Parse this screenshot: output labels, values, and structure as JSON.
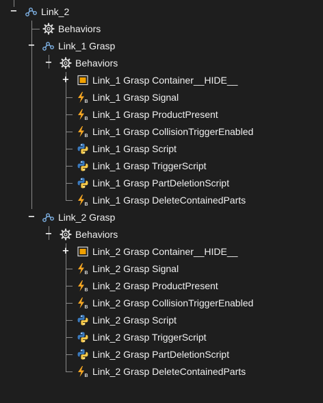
{
  "tree": {
    "root": {
      "label": "Link_2",
      "toggle": "−",
      "icon": "link-joint-icon"
    },
    "behaviors_root": {
      "label": "Behaviors",
      "icon": "gear-icon"
    },
    "groups": [
      {
        "label": "Link_1 Grasp",
        "toggle": "−",
        "icon": "link-joint-icon",
        "behaviors": {
          "label": "Behaviors",
          "toggle": "−",
          "icon": "gear-icon"
        },
        "items": [
          {
            "label": "Link_1 Grasp Container__HIDE__",
            "icon": "container-icon",
            "toggle": "+"
          },
          {
            "label": "Link_1 Grasp Signal",
            "icon": "signal-icon"
          },
          {
            "label": "Link_1 Grasp ProductPresent",
            "icon": "signal-icon"
          },
          {
            "label": "Link_1 Grasp CollisionTriggerEnabled",
            "icon": "signal-icon"
          },
          {
            "label": "Link_1 Grasp Script",
            "icon": "python-icon"
          },
          {
            "label": "Link_1 Grasp TriggerScript",
            "icon": "python-icon"
          },
          {
            "label": "Link_1 Grasp PartDeletionScript",
            "icon": "python-icon"
          },
          {
            "label": "Link_1 Grasp DeleteContainedParts",
            "icon": "signal-icon"
          }
        ]
      },
      {
        "label": "Link_2 Grasp",
        "toggle": "−",
        "icon": "link-joint-icon",
        "behaviors": {
          "label": "Behaviors",
          "toggle": "−",
          "icon": "gear-icon"
        },
        "items": [
          {
            "label": "Link_2 Grasp Container__HIDE__",
            "icon": "container-icon",
            "toggle": "+"
          },
          {
            "label": "Link_2 Grasp Signal",
            "icon": "signal-icon"
          },
          {
            "label": "Link_2 Grasp ProductPresent",
            "icon": "signal-icon"
          },
          {
            "label": "Link_2 Grasp CollisionTriggerEnabled",
            "icon": "signal-icon"
          },
          {
            "label": "Link_2 Grasp Script",
            "icon": "python-icon"
          },
          {
            "label": "Link_2 Grasp TriggerScript",
            "icon": "python-icon"
          },
          {
            "label": "Link_2 Grasp PartDeletionScript",
            "icon": "python-icon"
          },
          {
            "label": "Link_2 Grasp DeleteContainedParts",
            "icon": "signal-icon"
          }
        ]
      }
    ]
  },
  "colors": {
    "background": "#1e1e1e",
    "text": "#f0f0f0",
    "tree_lines": "#8a8a8a",
    "signal_bolt": "#f5a623",
    "container_fill": "#f0a000",
    "python_blue": "#3b7bbf",
    "python_yellow": "#f7c948",
    "link_icon": "#7fb3e6"
  }
}
